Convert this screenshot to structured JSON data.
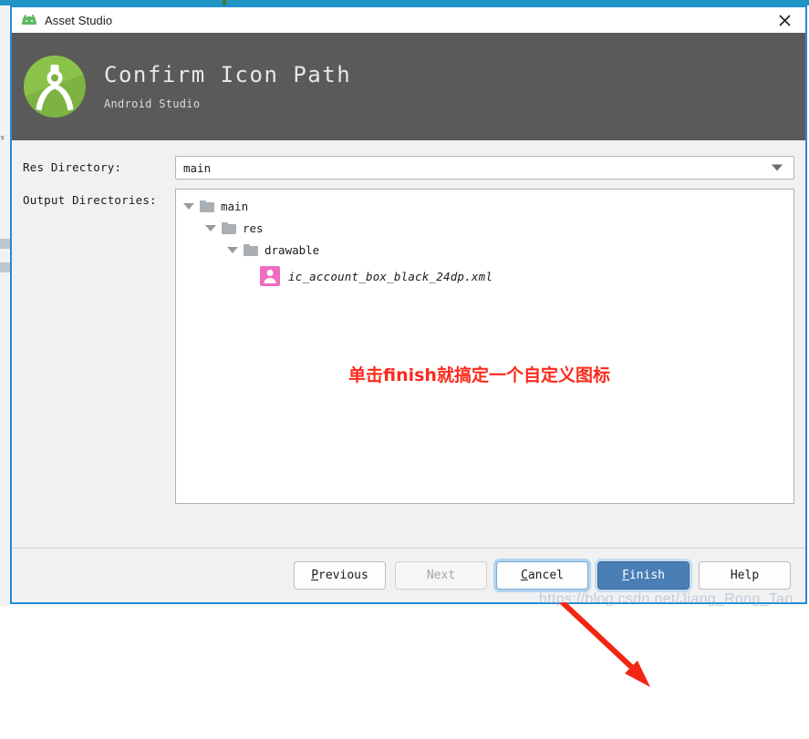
{
  "window": {
    "title": "Asset Studio",
    "app_icon": "android-head-icon",
    "close_icon": "close-icon"
  },
  "header": {
    "logo_icon": "android-studio-logo-icon",
    "title": "Confirm Icon Path",
    "subtitle": "Android Studio",
    "background_color": "#5a5a5a"
  },
  "form": {
    "res_directory": {
      "label": "Res Directory:",
      "value": "main",
      "dropdown_icon": "chevron-down-icon"
    },
    "output_directories": {
      "label": "Output Directories:",
      "tree": [
        {
          "name": "main",
          "icon": "folder-icon",
          "depth": 0,
          "expanded": true
        },
        {
          "name": "res",
          "icon": "folder-icon",
          "depth": 1,
          "expanded": true
        },
        {
          "name": "drawable",
          "icon": "folder-icon",
          "depth": 2,
          "expanded": true
        }
      ],
      "file": {
        "name": "ic_account_box_black_24dp.xml",
        "icon": "account-box-icon",
        "icon_color": "#ef6cc0"
      }
    }
  },
  "annotation": {
    "text": "单击finish就搞定一个自定义图标",
    "color": "#fa2b1e",
    "arrow_icon": "red-arrow-icon"
  },
  "footer": {
    "buttons": [
      {
        "label": "Previous",
        "accel": "P",
        "rest": "revious",
        "state": "normal"
      },
      {
        "label": "Next",
        "accel": "",
        "rest": "Next",
        "state": "disabled"
      },
      {
        "label": "Cancel",
        "accel": "C",
        "rest": "ancel",
        "state": "focused"
      },
      {
        "label": "Finish",
        "accel": "F",
        "rest": "inish",
        "state": "primary"
      },
      {
        "label": "Help",
        "accel": "",
        "rest": "Help",
        "state": "normal"
      }
    ]
  },
  "watermark": {
    "text": "https://blog.csdn.net/Jiang_Rong_Tao"
  },
  "background": {
    "left_marker": "s"
  }
}
